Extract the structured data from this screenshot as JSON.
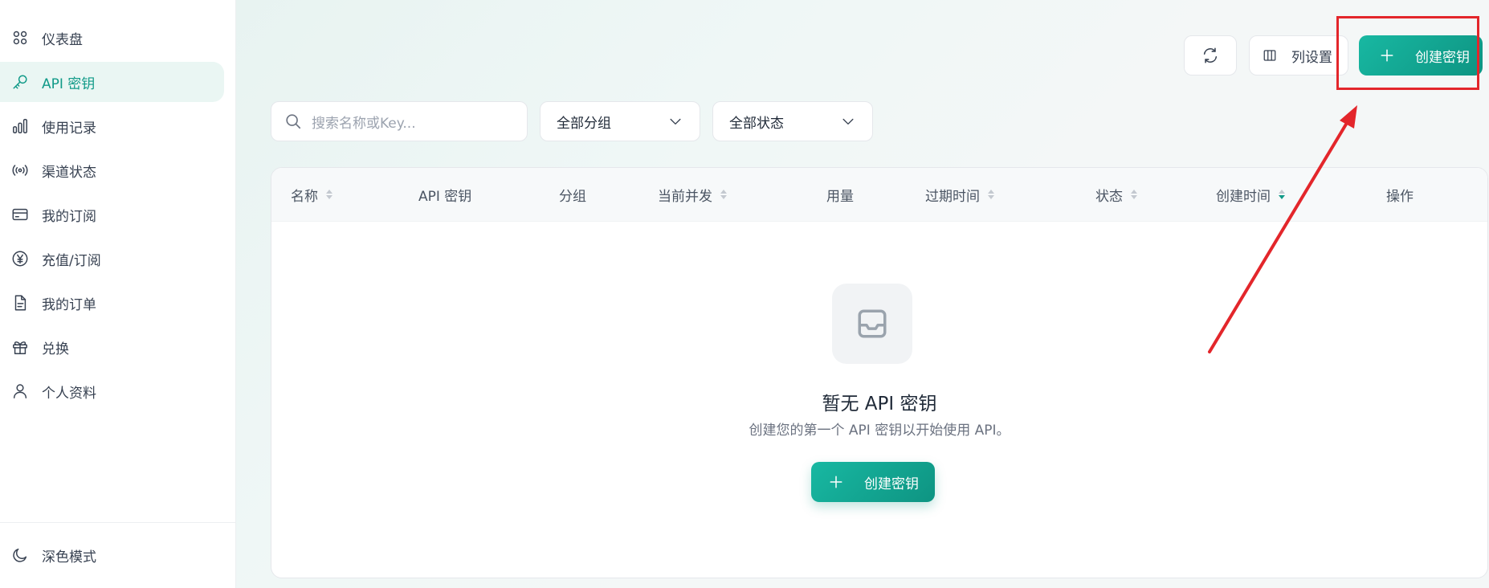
{
  "sidebar": {
    "items": [
      {
        "label": "仪表盘",
        "icon": "dashboard-grid-icon"
      },
      {
        "label": "API 密钥",
        "icon": "key-icon"
      },
      {
        "label": "使用记录",
        "icon": "bar-chart-icon"
      },
      {
        "label": "渠道状态",
        "icon": "broadcast-icon"
      },
      {
        "label": "我的订阅",
        "icon": "credit-card-icon"
      },
      {
        "label": "充值/订阅",
        "icon": "yen-coin-icon"
      },
      {
        "label": "我的订单",
        "icon": "document-icon"
      },
      {
        "label": "兑换",
        "icon": "gift-icon"
      },
      {
        "label": "个人资料",
        "icon": "user-icon"
      }
    ],
    "active_index": 1,
    "dark_mode_label": "深色模式"
  },
  "toolbar": {
    "refresh_icon": "refresh-icon",
    "columns_label": "列设置",
    "create_label": "创建密钥"
  },
  "filters": {
    "search_placeholder": "搜索名称或Key...",
    "group_value": "全部分组",
    "status_value": "全部状态"
  },
  "table": {
    "columns": [
      "名称",
      "API 密钥",
      "分组",
      "当前并发",
      "用量",
      "过期时间",
      "状态",
      "创建时间",
      "操作"
    ]
  },
  "empty_state": {
    "icon": "inbox-icon",
    "title": "暂无 API 密钥",
    "description": "创建您的第一个 API 密钥以开始使用 API。",
    "button_label": "创建密钥"
  },
  "colors": {
    "accent": "#119a88",
    "button_gradient_start": "#18b8a2",
    "button_gradient_end": "#0e9482",
    "annotation_red": "#e3262b"
  }
}
